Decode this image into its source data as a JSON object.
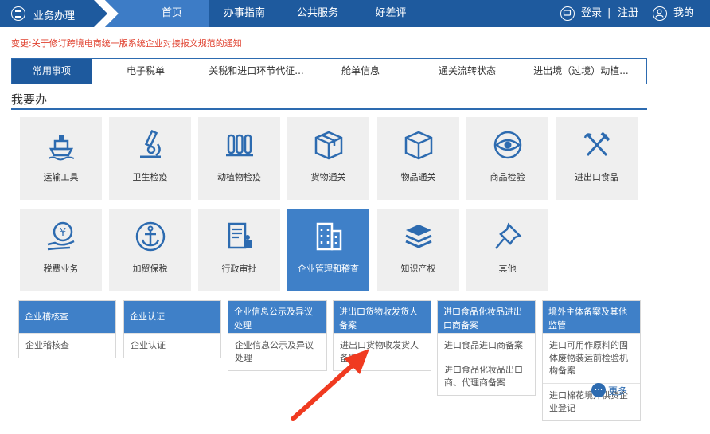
{
  "nav": {
    "business": "业务办理",
    "items": [
      "首页",
      "办事指南",
      "公共服务",
      "好差评"
    ],
    "login": "登录",
    "divider": "|",
    "register": "注册",
    "mine": "我的"
  },
  "notice": "变更:关于修订跨境电商统一版系统企业对接报文规范的通知",
  "tabs": [
    "常用事项",
    "电子税单",
    "关税和进口环节代征...",
    "舱单信息",
    "通关流转状态",
    "进出境（过境）动植..."
  ],
  "section_title": "我要办",
  "tiles": [
    "运输工具",
    "卫生检疫",
    "动植物检疫",
    "货物通关",
    "物品通关",
    "商品检验",
    "进出口食品",
    "税费业务",
    "加贸保税",
    "行政审批",
    "企业管理和稽查",
    "知识产权",
    "其他"
  ],
  "cards": [
    {
      "title": "企业稽核查",
      "items": [
        "企业稽核查"
      ]
    },
    {
      "title": "企业认证",
      "items": [
        "企业认证"
      ]
    },
    {
      "title": "企业信息公示及异议处理",
      "items": [
        "企业信息公示及异议处理"
      ]
    },
    {
      "title": "进出口货物收发货人备案",
      "items": [
        "进出口货物收发货人备案"
      ]
    },
    {
      "title": "进口食品化妆品进出口商备案",
      "items": [
        "进口食品进口商备案",
        "进口食品化妆品出口商、代理商备案"
      ]
    },
    {
      "title": "境外主体备案及其他监管",
      "items": [
        "进口可用作原料的固体废物装运前检验机构备案",
        "进口棉花境外供货企业登记"
      ]
    }
  ],
  "more": "更多",
  "more_icon": "···",
  "colors": {
    "nav": "#1e5a9e",
    "nav_active": "#3d7cc6",
    "tile_active": "#3f80c8",
    "notice": "#e0412f",
    "arrow": "#f03a20"
  }
}
